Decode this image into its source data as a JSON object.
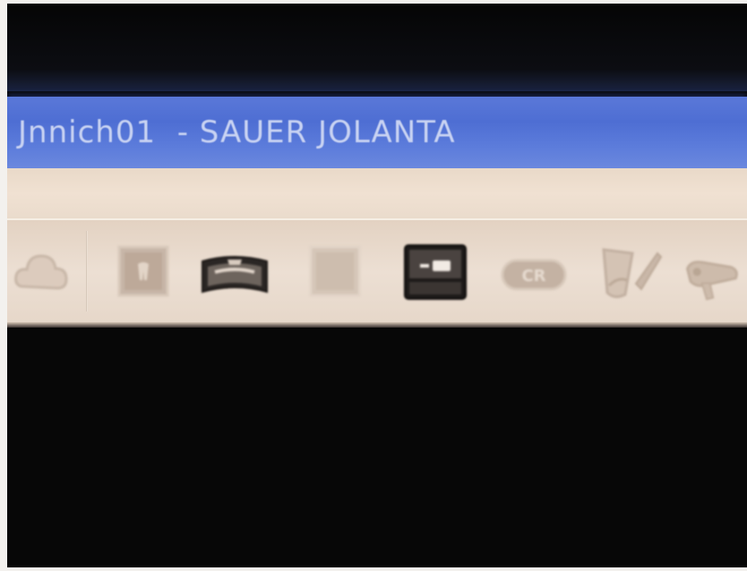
{
  "window": {
    "title": "Jnnich01  - SAUER JOLANTA"
  },
  "toolbar": {
    "buttons": [
      {
        "icon": "cloud-icon",
        "state": "disabled"
      },
      {
        "icon": "tooth-image-icon",
        "state": "disabled"
      },
      {
        "icon": "panoramic-xray-icon",
        "state": "enabled"
      },
      {
        "icon": "blank-image-icon",
        "state": "disabled"
      },
      {
        "icon": "sensor-icon",
        "state": "active"
      },
      {
        "icon": "cr-plate-icon",
        "state": "disabled"
      },
      {
        "icon": "draw-tool-icon",
        "state": "disabled"
      },
      {
        "icon": "intraoral-camera-icon",
        "state": "disabled"
      }
    ]
  },
  "colors": {
    "titlebar": "#5a78d8",
    "title_text": "#c9d3f2",
    "toolbar_bg": "#ecdfd3",
    "screen_dark": "#070707"
  }
}
